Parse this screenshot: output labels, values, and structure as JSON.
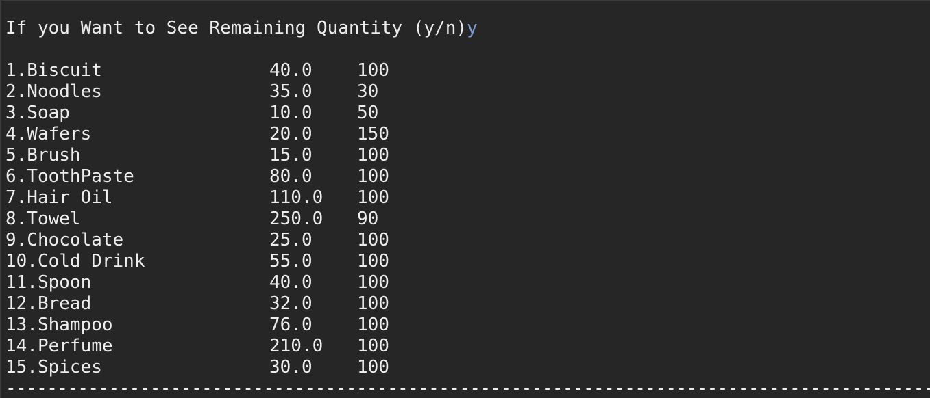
{
  "console": {
    "prompt": "If you Want to See Remaining Quantity (y/n)",
    "user_input": "y",
    "items": [
      {
        "name": "1.Biscuit",
        "price": "40.0",
        "qty": "100"
      },
      {
        "name": "2.Noodles",
        "price": "35.0",
        "qty": "30"
      },
      {
        "name": "3.Soap",
        "price": "10.0",
        "qty": "50"
      },
      {
        "name": "4.Wafers",
        "price": "20.0",
        "qty": "150"
      },
      {
        "name": "5.Brush",
        "price": "15.0",
        "qty": "100"
      },
      {
        "name": "6.ToothPaste",
        "price": "80.0",
        "qty": "100"
      },
      {
        "name": "7.Hair Oil",
        "price": "110.0",
        "qty": "100"
      },
      {
        "name": "8.Towel",
        "price": "250.0",
        "qty": "90"
      },
      {
        "name": "9.Chocolate",
        "price": "25.0",
        "qty": "100"
      },
      {
        "name": "10.Cold Drink",
        "price": "55.0",
        "qty": "100"
      },
      {
        "name": "11.Spoon",
        "price": "40.0",
        "qty": "100"
      },
      {
        "name": "12.Bread",
        "price": "32.0",
        "qty": "100"
      },
      {
        "name": "13.Shampoo",
        "price": "76.0",
        "qty": "100"
      },
      {
        "name": "14.Perfume",
        "price": "210.0",
        "qty": "100"
      },
      {
        "name": "15.Spices",
        "price": "30.0",
        "qty": "100"
      }
    ],
    "divider": "------------------------------------------------------------------------------------------------------------------------------------------------------"
  },
  "colors": {
    "background": "#262626",
    "text": "#ededed",
    "user_input": "#7d9ecf"
  }
}
